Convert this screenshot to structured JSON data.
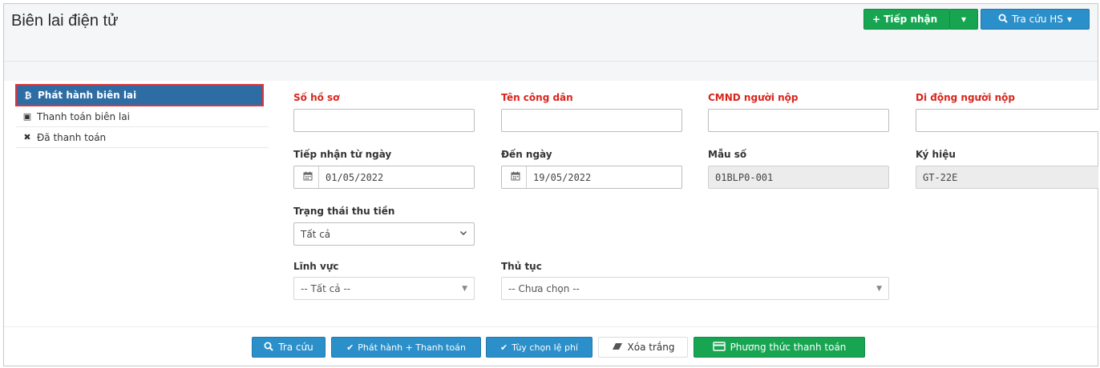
{
  "header": {
    "title": "Biên lai điện tử",
    "receive_button": "+ Tiếp nhận",
    "receive_dropdown": "▾",
    "lookup_button": "Tra cứu HS",
    "lookup_dropdown": "▾"
  },
  "sidebar": {
    "items": [
      {
        "icon": "bitcoin-icon",
        "glyph": "₿",
        "label": "Phát hành biên lai",
        "active": true
      },
      {
        "icon": "money-icon",
        "glyph": "▣",
        "label": "Thanh toán biên lai",
        "active": false
      },
      {
        "icon": "close-icon",
        "glyph": "✖",
        "label": "Đã thanh toán",
        "active": false
      }
    ]
  },
  "form": {
    "so_ho_so": {
      "label": "Số hồ sơ",
      "value": ""
    },
    "ten_cong_dan": {
      "label": "Tên công dân",
      "value": ""
    },
    "cmnd": {
      "label": "CMND người nộp",
      "value": ""
    },
    "di_dong": {
      "label": "Di động người nộp",
      "value": ""
    },
    "tu_ngay": {
      "label": "Tiếp nhận từ ngày",
      "value": "01/05/2022"
    },
    "den_ngay": {
      "label": "Đến ngày",
      "value": "19/05/2022"
    },
    "mau_so": {
      "label": "Mẫu số",
      "value": "01BLP0-001"
    },
    "ky_hieu": {
      "label": "Ký hiệu",
      "value": "GT-22E"
    },
    "trang_thai": {
      "label": "Trạng thái thu tiền",
      "value": "Tất cả"
    },
    "linh_vuc": {
      "label": "Lĩnh vực",
      "value": "-- Tất cả --"
    },
    "thu_tuc": {
      "label": "Thủ tục",
      "value": "-- Chưa chọn --"
    }
  },
  "footer": {
    "search": "Tra cứu",
    "issue_pay": "Phát hành + Thanh toán",
    "fee_option": "Tùy chọn lệ phí",
    "clear": "Xóa trắng",
    "payment_method": "Phương thức thanh toán"
  },
  "colors": {
    "green": "#18a552",
    "blue": "#2b8fc9",
    "required_label": "#d9251c",
    "active_sidebar": "#2e6da4"
  }
}
